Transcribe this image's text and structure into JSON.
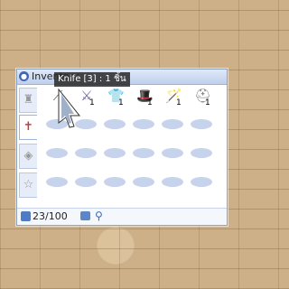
{
  "window": {
    "title": "Inventory"
  },
  "tabs": [
    {
      "name": "usable-items",
      "icon": "♜"
    },
    {
      "name": "equipment",
      "icon": "✝"
    },
    {
      "name": "etc",
      "icon": "◈"
    },
    {
      "name": "favorites",
      "icon": "☆"
    }
  ],
  "items": [
    {
      "name": "knife",
      "icon": "⟋",
      "qty": "1",
      "color": "#666666"
    },
    {
      "name": "sword",
      "icon": "⚔",
      "qty": "1",
      "color": "#6b5ba6"
    },
    {
      "name": "cotton-shirt",
      "icon": "👕",
      "qty": "1",
      "color": "#7a5a3a"
    },
    {
      "name": "hat",
      "icon": "🎩",
      "qty": "1",
      "color": "#e09060"
    },
    {
      "name": "rod",
      "icon": "🪄",
      "qty": "1",
      "color": "#c03030"
    },
    {
      "name": "helm",
      "icon": "⛑",
      "qty": "1",
      "color": "#888888"
    }
  ],
  "tooltip": {
    "text": "Knife [3] : 1 ชิ้น"
  },
  "status": {
    "count": "23/100"
  }
}
